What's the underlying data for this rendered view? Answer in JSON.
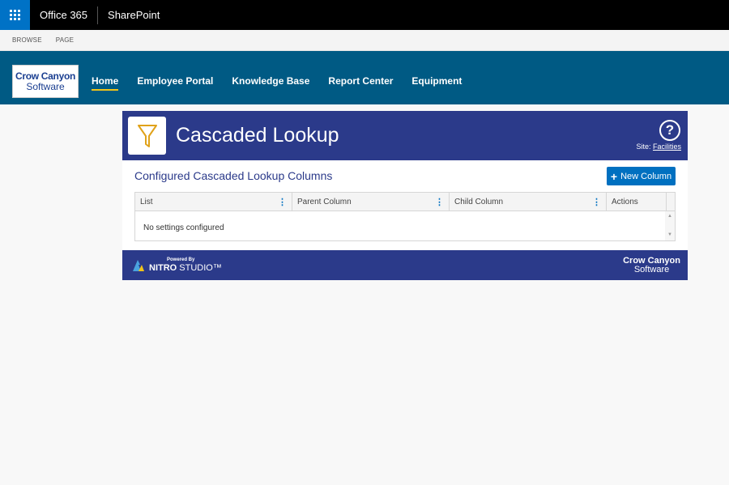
{
  "suitebar": {
    "brand": "Office 365",
    "product": "SharePoint"
  },
  "ribbon": {
    "tabs": [
      "BROWSE",
      "PAGE"
    ]
  },
  "site": {
    "logo_line1": "Crow Canyon",
    "logo_line2": "Software",
    "nav": [
      "Home",
      "Employee Portal",
      "Knowledge Base",
      "Report Center",
      "Equipment"
    ],
    "active_nav": "Home"
  },
  "app": {
    "title": "Cascaded Lookup",
    "icon": "filter-icon",
    "help_symbol": "?",
    "site_label": "Site:",
    "site_name": "Facilities",
    "section_title": "Configured Cascaded Lookup Columns",
    "new_column_label": "New Column",
    "grid": {
      "columns": [
        "List",
        "Parent Column",
        "Child Column",
        "Actions"
      ],
      "empty_message": "No settings configured"
    },
    "footer": {
      "powered_by": "Powered By",
      "nitro": "NITRO",
      "studio": "STUDIO™",
      "brand_line1": "Crow Canyon",
      "brand_line2": "Software"
    }
  },
  "colors": {
    "suitebar": "#000000",
    "waffle": "#0072c6",
    "site_header": "#005a84",
    "app_header": "#2b3a8a",
    "accent_button": "#0070c0",
    "nav_underline": "#f0c419"
  }
}
